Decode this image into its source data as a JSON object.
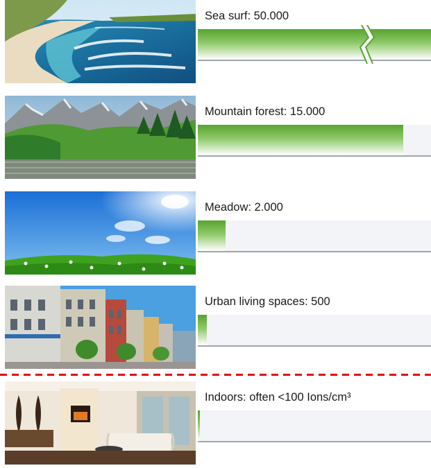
{
  "chart_data": {
    "type": "bar",
    "orientation": "horizontal",
    "categories": [
      "Sea surf",
      "Mountain forest",
      "Meadow",
      "Urban living spaces",
      "Indoors"
    ],
    "values": [
      50000,
      15000,
      2000,
      500,
      100
    ],
    "display_labels": [
      "Sea surf: 50.000",
      "Mountain forest: 15.000",
      "Meadow: 2.000",
      "Urban living spaces: 500",
      "Indoors: often <100 Ions/cm³"
    ],
    "axis_break_on": "Sea surf",
    "scale_max": 17000,
    "grid": false,
    "legend": "none"
  },
  "colors": {
    "bar_top": "#57a42f",
    "bar_mid": "#8fc96a",
    "track": "#f2f4f8",
    "track_border": "#9fa5ad",
    "divider": "#e3001b"
  },
  "images": [
    "sea-surf-photo",
    "mountain-forest-photo",
    "meadow-photo",
    "urban-street-photo",
    "indoor-living-room-photo"
  ]
}
